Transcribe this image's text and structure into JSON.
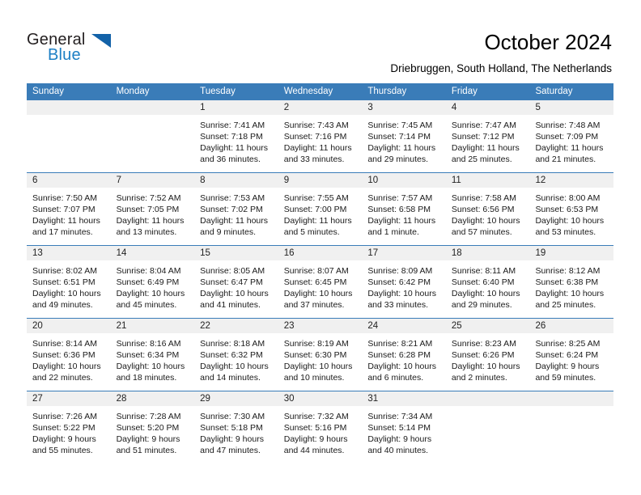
{
  "brand": {
    "name_top": "General",
    "name_bottom": "Blue",
    "logo_icon": "triangle-logo-icon",
    "accent_color": "#1c7fc4"
  },
  "header": {
    "title": "October 2024",
    "subtitle": "Driebruggen, South Holland, The Netherlands"
  },
  "theme": {
    "header_row_bg": "#3a7cb8",
    "day_band_bg": "#f0f0f0",
    "grid_line": "#3a7cb8"
  },
  "weekdays": [
    "Sunday",
    "Monday",
    "Tuesday",
    "Wednesday",
    "Thursday",
    "Friday",
    "Saturday"
  ],
  "weeks": [
    [
      {
        "day": "",
        "sunrise": "",
        "sunset": "",
        "daylight_line1": "",
        "daylight_line2": ""
      },
      {
        "day": "",
        "sunrise": "",
        "sunset": "",
        "daylight_line1": "",
        "daylight_line2": ""
      },
      {
        "day": "1",
        "sunrise": "Sunrise: 7:41 AM",
        "sunset": "Sunset: 7:18 PM",
        "daylight_line1": "Daylight: 11 hours",
        "daylight_line2": "and 36 minutes."
      },
      {
        "day": "2",
        "sunrise": "Sunrise: 7:43 AM",
        "sunset": "Sunset: 7:16 PM",
        "daylight_line1": "Daylight: 11 hours",
        "daylight_line2": "and 33 minutes."
      },
      {
        "day": "3",
        "sunrise": "Sunrise: 7:45 AM",
        "sunset": "Sunset: 7:14 PM",
        "daylight_line1": "Daylight: 11 hours",
        "daylight_line2": "and 29 minutes."
      },
      {
        "day": "4",
        "sunrise": "Sunrise: 7:47 AM",
        "sunset": "Sunset: 7:12 PM",
        "daylight_line1": "Daylight: 11 hours",
        "daylight_line2": "and 25 minutes."
      },
      {
        "day": "5",
        "sunrise": "Sunrise: 7:48 AM",
        "sunset": "Sunset: 7:09 PM",
        "daylight_line1": "Daylight: 11 hours",
        "daylight_line2": "and 21 minutes."
      }
    ],
    [
      {
        "day": "6",
        "sunrise": "Sunrise: 7:50 AM",
        "sunset": "Sunset: 7:07 PM",
        "daylight_line1": "Daylight: 11 hours",
        "daylight_line2": "and 17 minutes."
      },
      {
        "day": "7",
        "sunrise": "Sunrise: 7:52 AM",
        "sunset": "Sunset: 7:05 PM",
        "daylight_line1": "Daylight: 11 hours",
        "daylight_line2": "and 13 minutes."
      },
      {
        "day": "8",
        "sunrise": "Sunrise: 7:53 AM",
        "sunset": "Sunset: 7:02 PM",
        "daylight_line1": "Daylight: 11 hours",
        "daylight_line2": "and 9 minutes."
      },
      {
        "day": "9",
        "sunrise": "Sunrise: 7:55 AM",
        "sunset": "Sunset: 7:00 PM",
        "daylight_line1": "Daylight: 11 hours",
        "daylight_line2": "and 5 minutes."
      },
      {
        "day": "10",
        "sunrise": "Sunrise: 7:57 AM",
        "sunset": "Sunset: 6:58 PM",
        "daylight_line1": "Daylight: 11 hours",
        "daylight_line2": "and 1 minute."
      },
      {
        "day": "11",
        "sunrise": "Sunrise: 7:58 AM",
        "sunset": "Sunset: 6:56 PM",
        "daylight_line1": "Daylight: 10 hours",
        "daylight_line2": "and 57 minutes."
      },
      {
        "day": "12",
        "sunrise": "Sunrise: 8:00 AM",
        "sunset": "Sunset: 6:53 PM",
        "daylight_line1": "Daylight: 10 hours",
        "daylight_line2": "and 53 minutes."
      }
    ],
    [
      {
        "day": "13",
        "sunrise": "Sunrise: 8:02 AM",
        "sunset": "Sunset: 6:51 PM",
        "daylight_line1": "Daylight: 10 hours",
        "daylight_line2": "and 49 minutes."
      },
      {
        "day": "14",
        "sunrise": "Sunrise: 8:04 AM",
        "sunset": "Sunset: 6:49 PM",
        "daylight_line1": "Daylight: 10 hours",
        "daylight_line2": "and 45 minutes."
      },
      {
        "day": "15",
        "sunrise": "Sunrise: 8:05 AM",
        "sunset": "Sunset: 6:47 PM",
        "daylight_line1": "Daylight: 10 hours",
        "daylight_line2": "and 41 minutes."
      },
      {
        "day": "16",
        "sunrise": "Sunrise: 8:07 AM",
        "sunset": "Sunset: 6:45 PM",
        "daylight_line1": "Daylight: 10 hours",
        "daylight_line2": "and 37 minutes."
      },
      {
        "day": "17",
        "sunrise": "Sunrise: 8:09 AM",
        "sunset": "Sunset: 6:42 PM",
        "daylight_line1": "Daylight: 10 hours",
        "daylight_line2": "and 33 minutes."
      },
      {
        "day": "18",
        "sunrise": "Sunrise: 8:11 AM",
        "sunset": "Sunset: 6:40 PM",
        "daylight_line1": "Daylight: 10 hours",
        "daylight_line2": "and 29 minutes."
      },
      {
        "day": "19",
        "sunrise": "Sunrise: 8:12 AM",
        "sunset": "Sunset: 6:38 PM",
        "daylight_line1": "Daylight: 10 hours",
        "daylight_line2": "and 25 minutes."
      }
    ],
    [
      {
        "day": "20",
        "sunrise": "Sunrise: 8:14 AM",
        "sunset": "Sunset: 6:36 PM",
        "daylight_line1": "Daylight: 10 hours",
        "daylight_line2": "and 22 minutes."
      },
      {
        "day": "21",
        "sunrise": "Sunrise: 8:16 AM",
        "sunset": "Sunset: 6:34 PM",
        "daylight_line1": "Daylight: 10 hours",
        "daylight_line2": "and 18 minutes."
      },
      {
        "day": "22",
        "sunrise": "Sunrise: 8:18 AM",
        "sunset": "Sunset: 6:32 PM",
        "daylight_line1": "Daylight: 10 hours",
        "daylight_line2": "and 14 minutes."
      },
      {
        "day": "23",
        "sunrise": "Sunrise: 8:19 AM",
        "sunset": "Sunset: 6:30 PM",
        "daylight_line1": "Daylight: 10 hours",
        "daylight_line2": "and 10 minutes."
      },
      {
        "day": "24",
        "sunrise": "Sunrise: 8:21 AM",
        "sunset": "Sunset: 6:28 PM",
        "daylight_line1": "Daylight: 10 hours",
        "daylight_line2": "and 6 minutes."
      },
      {
        "day": "25",
        "sunrise": "Sunrise: 8:23 AM",
        "sunset": "Sunset: 6:26 PM",
        "daylight_line1": "Daylight: 10 hours",
        "daylight_line2": "and 2 minutes."
      },
      {
        "day": "26",
        "sunrise": "Sunrise: 8:25 AM",
        "sunset": "Sunset: 6:24 PM",
        "daylight_line1": "Daylight: 9 hours",
        "daylight_line2": "and 59 minutes."
      }
    ],
    [
      {
        "day": "27",
        "sunrise": "Sunrise: 7:26 AM",
        "sunset": "Sunset: 5:22 PM",
        "daylight_line1": "Daylight: 9 hours",
        "daylight_line2": "and 55 minutes."
      },
      {
        "day": "28",
        "sunrise": "Sunrise: 7:28 AM",
        "sunset": "Sunset: 5:20 PM",
        "daylight_line1": "Daylight: 9 hours",
        "daylight_line2": "and 51 minutes."
      },
      {
        "day": "29",
        "sunrise": "Sunrise: 7:30 AM",
        "sunset": "Sunset: 5:18 PM",
        "daylight_line1": "Daylight: 9 hours",
        "daylight_line2": "and 47 minutes."
      },
      {
        "day": "30",
        "sunrise": "Sunrise: 7:32 AM",
        "sunset": "Sunset: 5:16 PM",
        "daylight_line1": "Daylight: 9 hours",
        "daylight_line2": "and 44 minutes."
      },
      {
        "day": "31",
        "sunrise": "Sunrise: 7:34 AM",
        "sunset": "Sunset: 5:14 PM",
        "daylight_line1": "Daylight: 9 hours",
        "daylight_line2": "and 40 minutes."
      },
      {
        "day": "",
        "sunrise": "",
        "sunset": "",
        "daylight_line1": "",
        "daylight_line2": ""
      },
      {
        "day": "",
        "sunrise": "",
        "sunset": "",
        "daylight_line1": "",
        "daylight_line2": ""
      }
    ]
  ]
}
